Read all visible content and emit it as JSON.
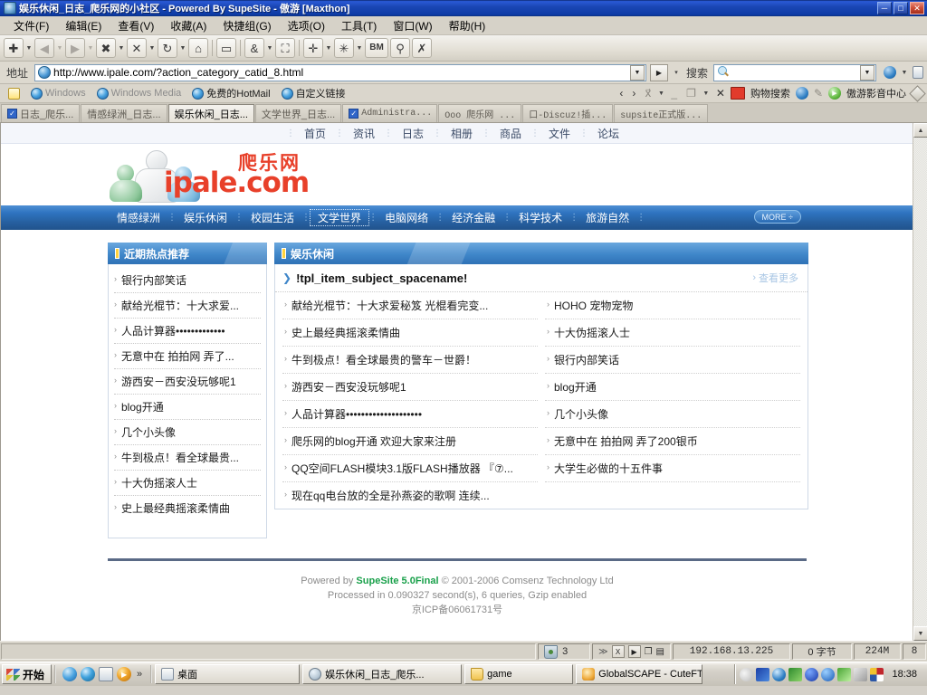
{
  "window": {
    "title": "娱乐休闲_日志_爬乐网的小社区 - Powered By SupeSite - 傲游 [Maxthon]",
    "minimize": "─",
    "maximize": "□",
    "close": "✕"
  },
  "menu": [
    "文件(F)",
    "编辑(E)",
    "查看(V)",
    "收藏(A)",
    "快捷组(G)",
    "选项(O)",
    "工具(T)",
    "窗口(W)",
    "帮助(H)"
  ],
  "toolbar": {
    "new_tab": "✚",
    "back": "◀",
    "forward": "▶",
    "stop_all": "✖",
    "close_tab": "✕",
    "refresh": "↻",
    "home": "⌂",
    "book": "▭",
    "amp": "&",
    "fullscreen": "⛶",
    "add": "✛",
    "bug": "✳",
    "bm": "BM",
    "wrench": "⚲",
    "close_x": "✗"
  },
  "address": {
    "label": "地址",
    "url": "http://www.ipale.com/?action_category_catid_8.html",
    "dropdown": "▼",
    "go": "▶",
    "go_arrow": "▾"
  },
  "search": {
    "label": "搜索",
    "value": "",
    "placeholder": "",
    "dropdown": "▼"
  },
  "links_bar": {
    "items": [
      "Windows",
      "Windows Media",
      "免费的HotMail",
      "自定义链接"
    ],
    "nav_back": "‹",
    "nav_fwd": "›",
    "nav_x": "✕",
    "shop_label": "购物搜索",
    "media_center_label": "傲游影音中心"
  },
  "tabs": [
    {
      "label": "日志_爬乐...",
      "checked": true,
      "active": false,
      "mono": false
    },
    {
      "label": "情感绿洲_日志...",
      "checked": false,
      "active": false,
      "mono": false
    },
    {
      "label": "娱乐休闲_日志...",
      "checked": false,
      "active": true,
      "mono": false
    },
    {
      "label": "文学世界_日志...",
      "checked": false,
      "active": false,
      "mono": false
    },
    {
      "label": "Administra...",
      "checked": true,
      "active": false,
      "mono": true
    },
    {
      "label": "Ooo 爬乐网 ...",
      "checked": false,
      "active": false,
      "mono": true
    },
    {
      "label": "口-Discuz!插...",
      "checked": false,
      "active": false,
      "mono": true
    },
    {
      "label": "supsite正式版...",
      "checked": false,
      "active": false,
      "mono": true
    }
  ],
  "site": {
    "topnav": [
      "首页",
      "资讯",
      "日志",
      "相册",
      "商品",
      "文件",
      "论坛"
    ],
    "logo_cn": "爬乐网",
    "logo_en": "ipale.com",
    "categories": [
      {
        "label": "情感绿洲",
        "selected": false
      },
      {
        "label": "娱乐休闲",
        "selected": false
      },
      {
        "label": "校园生活",
        "selected": false
      },
      {
        "label": "文学世界",
        "selected": true
      },
      {
        "label": "电脑网络",
        "selected": false
      },
      {
        "label": "经济金融",
        "selected": false
      },
      {
        "label": "科学技术",
        "selected": false
      },
      {
        "label": "旅游自然",
        "selected": false
      }
    ],
    "more_label": "MORE ÷",
    "left_panel": {
      "title": "近期热点推荐",
      "items": [
        "银行内部笑话",
        "献给光棍节：十大求爱...",
        "人品计算器•••••••••••••",
        "无意中在 拍拍网 弄了...",
        "游西安－西安没玩够呢1",
        "blog开通",
        "几个小头像",
        "牛到极点！看全球最贵...",
        "十大伪摇滚人士",
        "史上最经典摇滚柔情曲"
      ]
    },
    "right_panel": {
      "title": "娱乐休闲",
      "feature_title": "!tpl_item_subject_spacename!",
      "more_label": "查看更多",
      "col_left": [
        "献给光棍节：十大求爱秘笈 光棍看完变...",
        "史上最经典摇滚柔情曲",
        "牛到极点！看全球最贵的警车－世爵！",
        "游西安－西安没玩够呢1",
        "人品计算器••••••••••••••••••••",
        "爬乐网的blog开通 欢迎大家来注册",
        "QQ空间FLASH模块3.1版FLASH播放器 『⑦...",
        "现在qq电台放的全是孙燕姿的歌啊 连续..."
      ],
      "col_right": [
        "HOHO 宠物宠物",
        "十大伪摇滚人士",
        "银行内部笑话",
        "blog开通",
        "几个小头像",
        "无意中在 拍拍网 弄了200银币",
        "大学生必做的十五件事"
      ]
    },
    "footer": {
      "line1_pre": "Powered by ",
      "line1_brand": "SupeSite 5.0Final",
      "line1_post": " © 2001-2006 Comsenz Technology Ltd",
      "line2": "Processed in 0.090327 second(s), 6 queries, Gzip enabled",
      "line3": "京ICP备06061731号"
    }
  },
  "statusbar": {
    "blocked_count": "3",
    "ip": "192.168.13.225",
    "bytes": "0 字节",
    "memory": "224M",
    "tab_count": "8",
    "btn_x": "X",
    "btn_play": "▶",
    "btn_copy": "❐",
    "btn_clip": "▤",
    "btn_skip": "≫"
  },
  "taskbar": {
    "start": "开始",
    "quicklaunch_more": "»",
    "items": [
      {
        "label": "桌面",
        "icon": "note-icon",
        "active": false
      },
      {
        "label": "娱乐休闲_日志_爬乐...",
        "icon": "globe-icon",
        "active": true
      },
      {
        "label": "game",
        "icon": "folder-icon",
        "active": false
      },
      {
        "label": "GlobalSCAPE - CuteFTP...",
        "icon": "cute-icon",
        "active": false
      }
    ],
    "clock": "18:38"
  },
  "colors": {
    "title_bar": "#0d3ba6",
    "site_accent": "#2f74c0",
    "panel_header": "#3f86c9",
    "logo_red": "#e8402a",
    "footer_green": "#19a04a",
    "face_bg": "#d4d0c8"
  }
}
